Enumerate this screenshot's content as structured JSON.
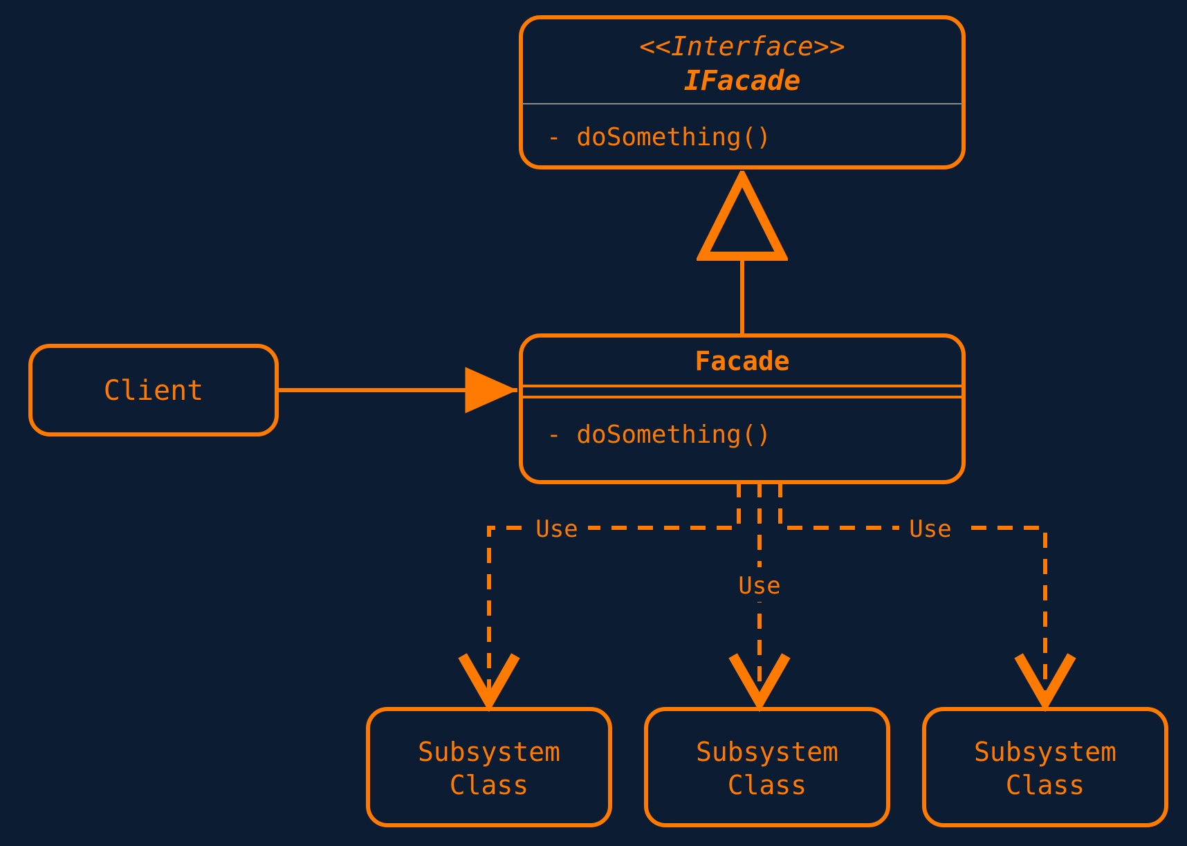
{
  "colors": {
    "bg": "#0b1c33",
    "accent": "#ff7a00",
    "divider": "#8a8a8a"
  },
  "client": {
    "label": "Client"
  },
  "interface": {
    "stereotype": "<<Interface>>",
    "name": "IFacade",
    "method": "- doSomething()"
  },
  "facade": {
    "name": "Facade",
    "method": "- doSomething()"
  },
  "subsystems": [
    {
      "line1": "Subsystem",
      "line2": "Class"
    },
    {
      "line1": "Subsystem",
      "line2": "Class"
    },
    {
      "line1": "Subsystem",
      "line2": "Class"
    }
  ],
  "edgeLabels": {
    "use": "Use"
  },
  "relationships": [
    {
      "from": "Client",
      "to": "Facade",
      "type": "association"
    },
    {
      "from": "Facade",
      "to": "IFacade",
      "type": "realization"
    },
    {
      "from": "Facade",
      "to": "Subsystem Class 1",
      "type": "dependency",
      "label": "Use"
    },
    {
      "from": "Facade",
      "to": "Subsystem Class 2",
      "type": "dependency",
      "label": "Use"
    },
    {
      "from": "Facade",
      "to": "Subsystem Class 3",
      "type": "dependency",
      "label": "Use"
    }
  ]
}
